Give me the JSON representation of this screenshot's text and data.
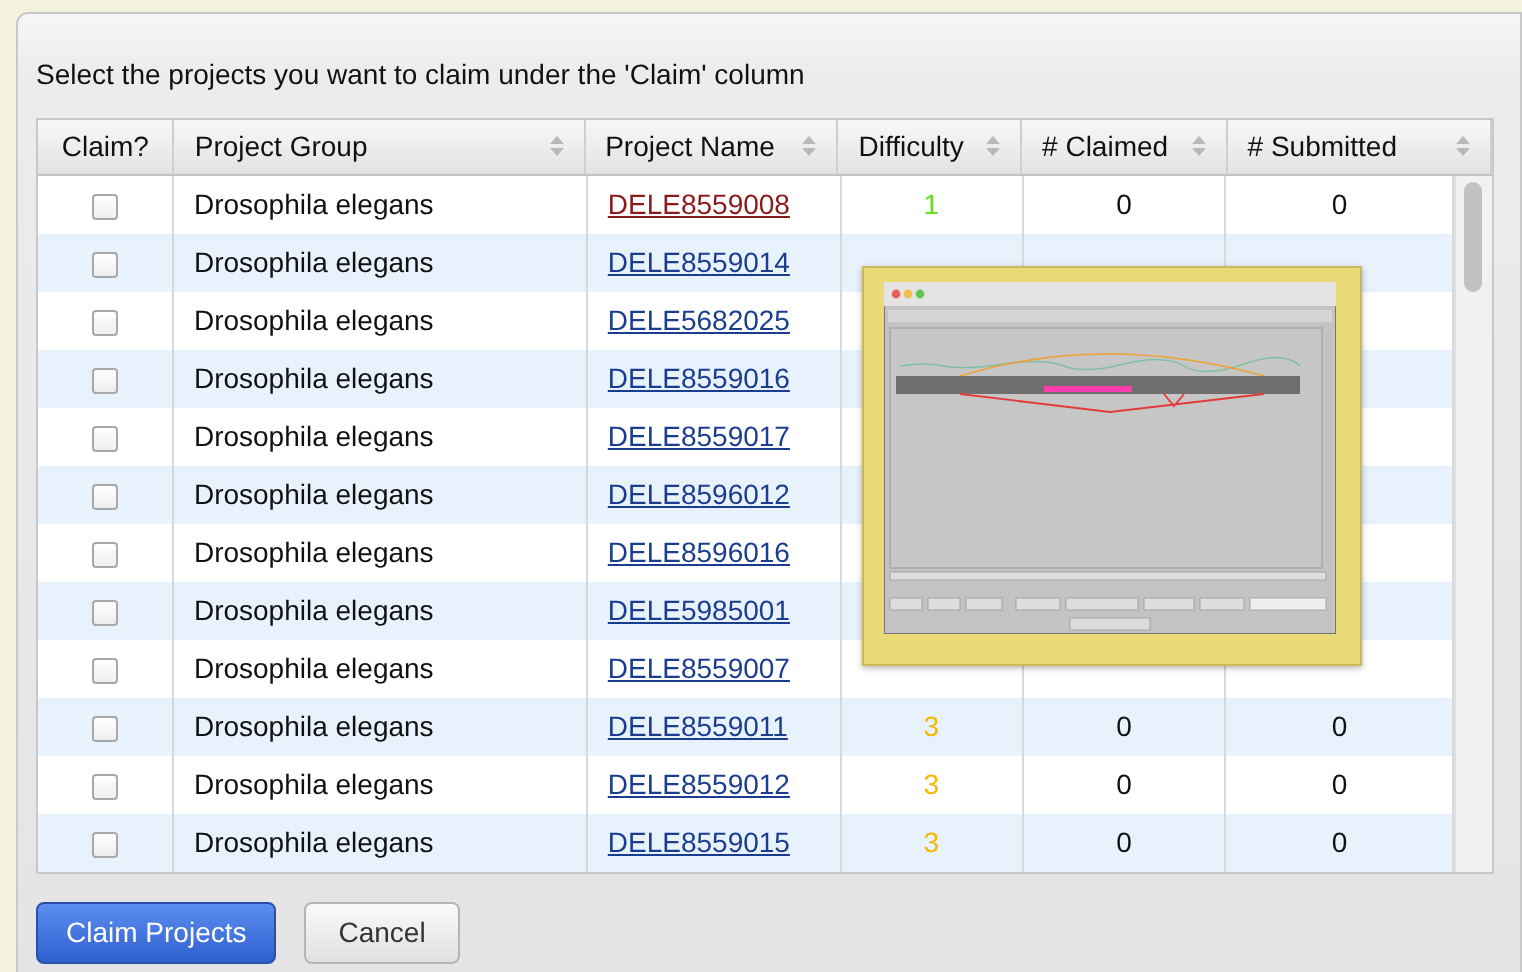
{
  "instruction": "Select the projects you want to claim under the 'Claim' column",
  "table": {
    "columns": [
      {
        "label": "Claim?",
        "sortable": false
      },
      {
        "label": "Project Group",
        "sortable": true
      },
      {
        "label": "Project Name",
        "sortable": true
      },
      {
        "label": "Difficulty",
        "sortable": true
      },
      {
        "label": "# Claimed",
        "sortable": true
      },
      {
        "label": "# Submitted",
        "sortable": true
      }
    ],
    "rows": [
      {
        "checked": false,
        "group": "Drosophila elegans",
        "name": "DELE8559008",
        "visited": true,
        "difficulty": {
          "text": "1",
          "color": "#66dd22"
        },
        "claimed": "0",
        "submitted": "0"
      },
      {
        "checked": false,
        "group": "Drosophila elegans",
        "name": "DELE8559014",
        "visited": false
      },
      {
        "checked": false,
        "group": "Drosophila elegans",
        "name": "DELE5682025",
        "visited": false
      },
      {
        "checked": false,
        "group": "Drosophila elegans",
        "name": "DELE8559016",
        "visited": false
      },
      {
        "checked": false,
        "group": "Drosophila elegans",
        "name": "DELE8559017",
        "visited": false
      },
      {
        "checked": false,
        "group": "Drosophila elegans",
        "name": "DELE8596012",
        "visited": false
      },
      {
        "checked": false,
        "group": "Drosophila elegans",
        "name": "DELE8596016",
        "visited": false
      },
      {
        "checked": false,
        "group": "Drosophila elegans",
        "name": "DELE5985001",
        "visited": false
      },
      {
        "checked": false,
        "group": "Drosophila elegans",
        "name": "DELE8559007",
        "visited": false
      },
      {
        "checked": false,
        "group": "Drosophila elegans",
        "name": "DELE8559011",
        "visited": false,
        "difficulty": {
          "text": "3",
          "color": "#f5b800"
        },
        "claimed": "0",
        "submitted": "0"
      },
      {
        "checked": false,
        "group": "Drosophila elegans",
        "name": "DELE8559012",
        "visited": false,
        "difficulty": {
          "text": "3",
          "color": "#f5b800"
        },
        "claimed": "0",
        "submitted": "0"
      },
      {
        "checked": false,
        "group": "Drosophila elegans",
        "name": "DELE8559015",
        "visited": false,
        "difficulty": {
          "text": "3",
          "color": "#f5b800"
        },
        "claimed": "0",
        "submitted": "0"
      }
    ]
  },
  "buttons": [
    {
      "label": "Claim Projects",
      "kind": "primary"
    },
    {
      "label": "Cancel",
      "kind": "secondary"
    }
  ]
}
